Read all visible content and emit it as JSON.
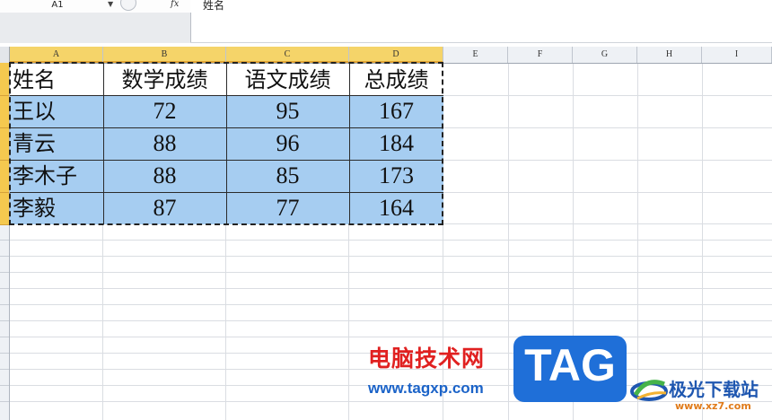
{
  "formula_bar": {
    "name_box": "A1",
    "fx_label": "fx",
    "content": "姓名"
  },
  "columns": [
    "A",
    "B",
    "C",
    "D",
    "E",
    "F",
    "G",
    "H",
    "I"
  ],
  "table": {
    "headers": [
      "姓名",
      "数学成绩",
      "语文成绩",
      "总成绩"
    ],
    "rows": [
      [
        "王以",
        "72",
        "95",
        "167"
      ],
      [
        "青云",
        "88",
        "96",
        "184"
      ],
      [
        "李木子",
        "88",
        "85",
        "173"
      ],
      [
        "李毅",
        "87",
        "77",
        "164"
      ]
    ]
  },
  "colors": {
    "selection_fill": "#a6cdf1",
    "header_highlight": "#f5d469",
    "watermark_red": "#e02020",
    "watermark_blue": "#1f6fd8"
  },
  "watermark": {
    "site_name": "电脑技术网",
    "site_url": "www.tagxp.com",
    "badge": "TAG",
    "logo_name": "极光下载站",
    "logo_url": "www.xz7.com"
  }
}
